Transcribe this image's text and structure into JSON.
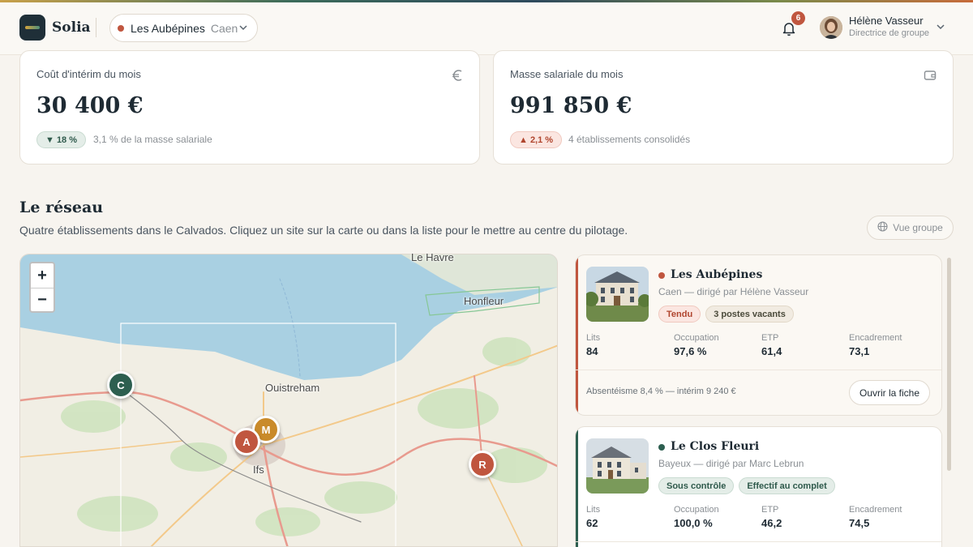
{
  "header": {
    "brand": "Solia",
    "site_selector": {
      "name": "Les Aubépines",
      "city": "Caen"
    },
    "notifications_count": "6",
    "user": {
      "name": "Hélène Vasseur",
      "role": "Directrice de groupe"
    }
  },
  "kpis": [
    {
      "label": "Coût d'intérim du mois",
      "icon": "euro-icon",
      "value": "30 400 €",
      "delta": "▼ 18 %",
      "trend": "down",
      "note": "3,1 % de la masse salariale"
    },
    {
      "label": "Masse salariale du mois",
      "icon": "wallet-icon",
      "value": "991 850 €",
      "delta": "▲ 2,1 %",
      "trend": "up",
      "note": "4 établissements consolidés"
    }
  ],
  "section": {
    "title": "Le réseau",
    "subtitle": "Quatre établissements dans le Calvados. Cliquez un site sur la carte ou dans la liste pour le mettre au centre du pilotage.",
    "group_view_button": "Vue groupe"
  },
  "map": {
    "zoom_in": "+",
    "zoom_out": "−",
    "place_labels": [
      "Le Havre",
      "Honfleur",
      "Ouistreham",
      "Ifs"
    ],
    "markers": [
      {
        "letter": "C",
        "color": "#2d5f50"
      },
      {
        "letter": "M",
        "color": "#c98a2a"
      },
      {
        "letter": "A",
        "color": "#c0563f"
      },
      {
        "letter": "R",
        "color": "#c0563f"
      }
    ]
  },
  "sites": [
    {
      "name": "Les Aubépines",
      "status_color": "#c0563f",
      "subtitle": "Caen — dirigé par Hélène Vasseur",
      "tags": [
        "Tendu",
        "3 postes vacants"
      ],
      "stats": [
        {
          "label": "Lits",
          "value": "84"
        },
        {
          "label": "Occupation",
          "value": "97,6 %"
        },
        {
          "label": "ETP",
          "value": "61,4"
        },
        {
          "label": "Encadrement",
          "value": "73,1"
        }
      ],
      "footer": "Absentéisme 8,4 % — intérim 9 240 €",
      "open_button": "Ouvrir la fiche"
    },
    {
      "name": "Le Clos Fleuri",
      "status_color": "#2d5f50",
      "subtitle": "Bayeux — dirigé par Marc Lebrun",
      "tags": [
        "Sous contrôle",
        "Effectif au complet"
      ],
      "stats": [
        {
          "label": "Lits",
          "value": "62"
        },
        {
          "label": "Occupation",
          "value": "100,0 %"
        },
        {
          "label": "ETP",
          "value": "46,2"
        },
        {
          "label": "Encadrement",
          "value": "74,5"
        }
      ]
    }
  ]
}
